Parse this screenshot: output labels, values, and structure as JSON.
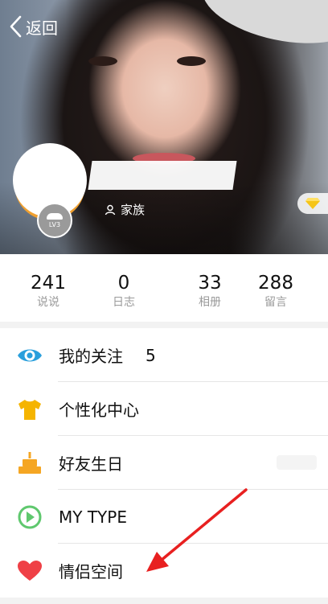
{
  "header": {
    "back_label": "返回",
    "family_label": "家族",
    "level_label": "LV3"
  },
  "stats": [
    {
      "value": "241",
      "label": "说说"
    },
    {
      "value": "0",
      "label": "日志"
    },
    {
      "value": "33",
      "label": "相册"
    },
    {
      "value": "288",
      "label": "留言"
    }
  ],
  "menu": [
    {
      "label": "我的关注",
      "count": "5",
      "icon": "eye-icon",
      "color": "#2a9fdc"
    },
    {
      "label": "个性化中心",
      "icon": "tshirt-icon",
      "color": "#f5b400"
    },
    {
      "label": "好友生日",
      "icon": "cake-icon",
      "color": "#f5a623"
    },
    {
      "label": "MY TYPE",
      "icon": "play-icon",
      "color": "#5fc86e"
    },
    {
      "label": "情侣空间",
      "icon": "heart-icon",
      "color": "#ef4046"
    }
  ],
  "annotation": {
    "arrow_color": "#e82020"
  }
}
